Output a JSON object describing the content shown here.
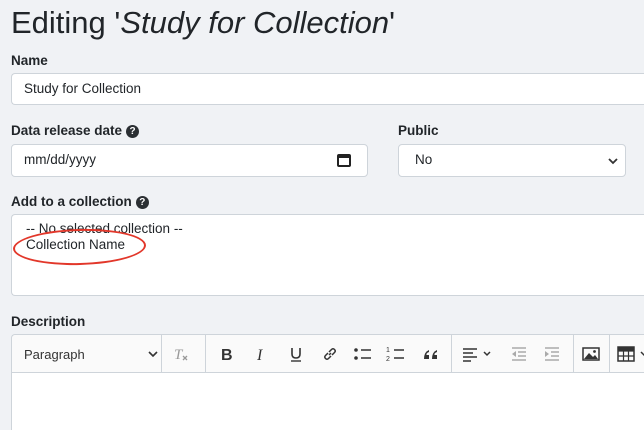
{
  "header": {
    "prefix": "Editing '",
    "study_name": "Study for Collection",
    "suffix": "'"
  },
  "form": {
    "name": {
      "label": "Name",
      "value": "Study for Collection"
    },
    "release_date": {
      "label": "Data release date",
      "placeholder": "mm/dd/yyyy",
      "help_icon": "question-circle-icon"
    },
    "public": {
      "label": "Public",
      "selected": "No"
    },
    "collection": {
      "label": "Add to a collection",
      "help_icon": "question-circle-icon",
      "options": [
        "-- No selected collection --",
        "Collection Name"
      ]
    },
    "description": {
      "label": "Description",
      "heading_select": "Paragraph"
    }
  },
  "annotation": {
    "color": "#e2372a",
    "target": "Collection Name"
  },
  "toolbar_icons": [
    "remove-format-icon",
    "bold-icon",
    "italic-icon",
    "underline-icon",
    "link-icon",
    "bulleted-list-icon",
    "numbered-list-icon",
    "block-quote-icon",
    "align-icon",
    "outdent-icon",
    "indent-icon",
    "image-icon",
    "table-icon"
  ]
}
